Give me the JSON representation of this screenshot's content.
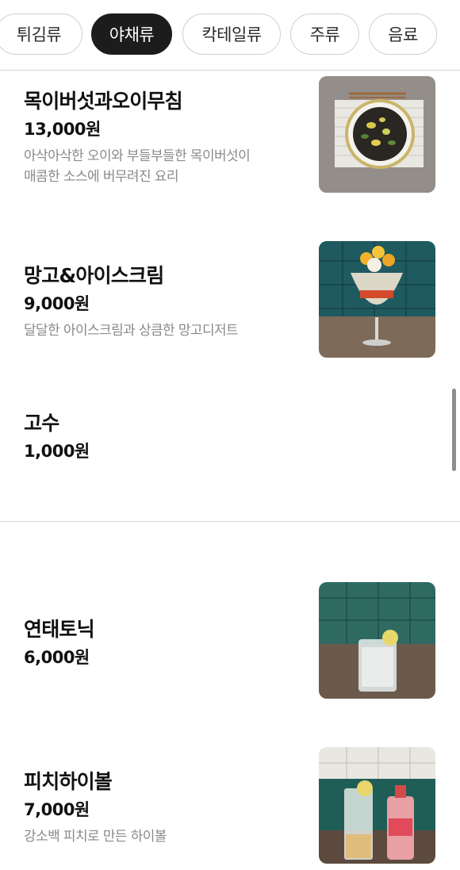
{
  "tabs": [
    {
      "label": "튀김류",
      "active": false
    },
    {
      "label": "야채류",
      "active": true
    },
    {
      "label": "칵테일류",
      "active": false
    },
    {
      "label": "주류",
      "active": false
    },
    {
      "label": "음료",
      "active": false
    }
  ],
  "menu": [
    {
      "title": "목이버섯과오이무침",
      "price": "13,000원",
      "desc_line1": "아삭아삭한 오이와 부들부들한 목이버섯이",
      "desc_line2": "매콤한 소스에 버무려진 요리",
      "image": "mushroom-cucumber-dish-photo"
    },
    {
      "title": "망고&아이스크림",
      "price": "9,000원",
      "desc_line1": "달달한 아이스크림과 상큼한 망고디저트",
      "image": "mango-parfait-photo"
    },
    {
      "title": "고수",
      "price": "1,000원"
    },
    {
      "title": "연태토닉",
      "price": "6,000원",
      "image": "tonic-glass-photo"
    },
    {
      "title": "피치하이볼",
      "price": "7,000원",
      "desc_line1": "강소백 피치로 만든 하이볼",
      "image": "peach-highball-photo"
    }
  ],
  "colors": {
    "active_tab": "#1c1c1c",
    "desc_text": "#8a8a8a",
    "divider": "#d7d7d7"
  }
}
